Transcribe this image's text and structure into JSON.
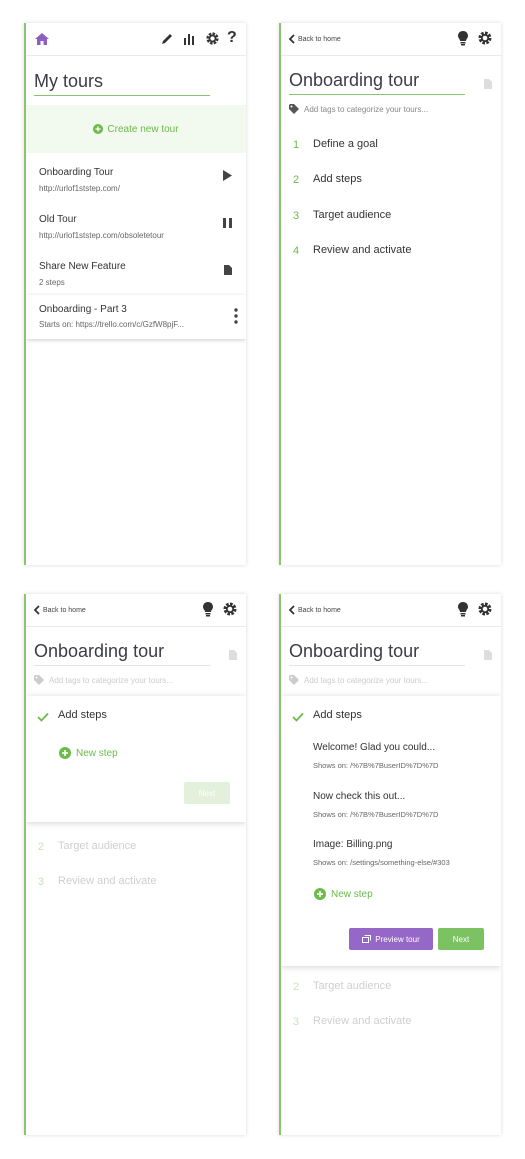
{
  "colors": {
    "accent_green": "#6cbb4a",
    "brand_purple": "#8e5fc2",
    "preview_purple": "#9567c7"
  },
  "panel1": {
    "title": "My tours",
    "create_label": "Create new tour",
    "icons": [
      "home-icon",
      "pencil-icon",
      "bar-chart-icon",
      "gear-icon",
      "help-icon"
    ],
    "tours": [
      {
        "name": "Onboarding Tour",
        "sub": "http://urlof1ststep.com/",
        "status_icon": "play-icon"
      },
      {
        "name": "Old Tour",
        "sub": "http://urlof1ststep.com/obsoletetour",
        "status_icon": "pause-icon"
      },
      {
        "name": "Share New Feature",
        "sub": "2 steps",
        "status_icon": "document-icon"
      },
      {
        "name": "Onboarding - Part 3",
        "sub": "Starts on: https://trello.com/c/GzfW8pjF...",
        "status_icon": "more-vertical-icon"
      }
    ]
  },
  "editor": {
    "back_label": "Back to home",
    "tour_title": "Onboarding tour",
    "tags_placeholder": "Add tags to categorize your tours...",
    "steps": [
      {
        "num": "1",
        "label": "Define a goal"
      },
      {
        "num": "2",
        "label": "Add steps"
      },
      {
        "num": "3",
        "label": "Target audience"
      },
      {
        "num": "4",
        "label": "Review and activate"
      }
    ]
  },
  "panel3": {
    "card_title": "Add steps",
    "new_step_label": "New step",
    "next_label": "Next",
    "following_steps": [
      {
        "num": "2",
        "label": "Target audience"
      },
      {
        "num": "3",
        "label": "Review and activate"
      }
    ]
  },
  "panel4": {
    "card_title": "Add steps",
    "substeps": [
      {
        "name": "Welcome! Glad you could...",
        "desc": "Shows on: /%7B%7BuserID%7D%7D"
      },
      {
        "name": "Now check this out...",
        "desc": "Shows on: /%7B%7BuserID%7D%7D"
      },
      {
        "name": "Image: Billing.png",
        "desc": "Shows on: /settings/something-else/#303"
      }
    ],
    "new_step_label": "New step",
    "preview_label": "Preview tour",
    "next_label": "Next",
    "following_steps": [
      {
        "num": "2",
        "label": "Target audience"
      },
      {
        "num": "3",
        "label": "Review and activate"
      }
    ]
  }
}
